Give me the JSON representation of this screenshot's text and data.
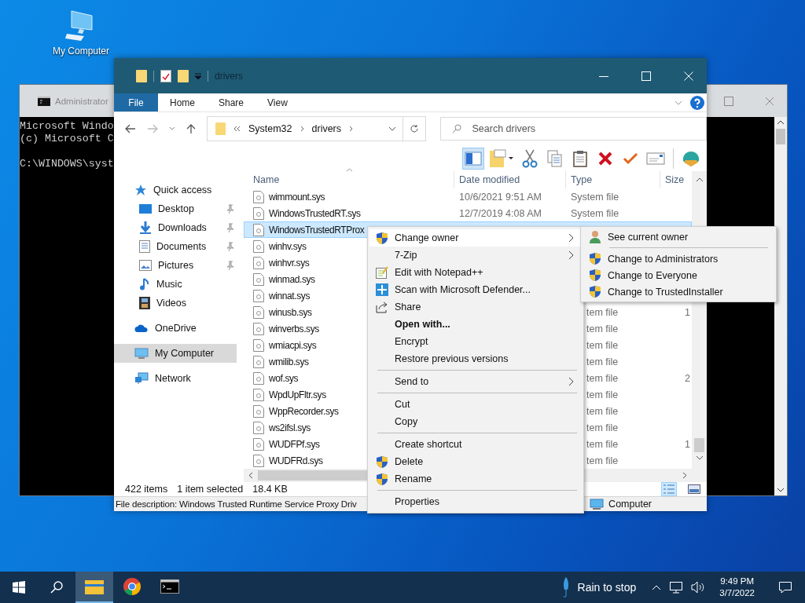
{
  "desktop_icons": [
    {
      "label": "My Computer"
    }
  ],
  "console_window": {
    "title": "Administrator",
    "blocks": [
      [
        "Microsoft Windo",
        "(c) Microsoft C"
      ],
      [
        "C:\\WINDOWS\\syst"
      ]
    ]
  },
  "explorer": {
    "title": "drivers",
    "ribbon_tabs": [
      {
        "label": "File",
        "selected": true
      },
      {
        "label": "Home",
        "selected": false
      },
      {
        "label": "Share",
        "selected": false
      },
      {
        "label": "View",
        "selected": false
      }
    ],
    "address": {
      "path": [
        "System32",
        "drivers"
      ]
    },
    "search": {
      "placeholder": "Search drivers"
    },
    "toolbar": [
      {
        "kind": "preview-pane",
        "selected": true
      },
      {
        "kind": "new-folder",
        "selected": false
      },
      {
        "kind": "cut",
        "selected": false
      },
      {
        "kind": "copy",
        "selected": false
      },
      {
        "kind": "paste",
        "selected": false
      },
      {
        "kind": "delete",
        "selected": false
      },
      {
        "kind": "check",
        "selected": false
      },
      {
        "kind": "mail",
        "selected": false
      },
      {
        "kind": "shell",
        "selected": false
      }
    ],
    "sidebar": [
      {
        "label": "Quick access",
        "selected": false,
        "children": [
          {
            "label": "Desktop",
            "pinned": true,
            "selected": false
          },
          {
            "label": "Downloads",
            "pinned": true,
            "selected": false
          },
          {
            "label": "Documents",
            "pinned": true,
            "selected": false
          },
          {
            "label": "Pictures",
            "pinned": true,
            "selected": false
          },
          {
            "label": "Music",
            "pinned": false,
            "selected": false
          },
          {
            "label": "Videos",
            "pinned": false,
            "selected": false
          }
        ]
      },
      {
        "label": "OneDrive",
        "selected": false
      },
      {
        "label": "My Computer",
        "selected": true
      },
      {
        "label": "Network",
        "selected": false
      }
    ],
    "columns": [
      {
        "label": "Name",
        "sorted": true
      },
      {
        "label": "Date modified",
        "sorted": false
      },
      {
        "label": "Type",
        "sorted": false
      },
      {
        "label": "Size",
        "sorted": false
      }
    ],
    "rows": [
      {
        "name": "wimmount.sys",
        "date": "10/6/2021 9:51 AM",
        "type": "System file",
        "selected": false
      },
      {
        "name": "WindowsTrustedRT.sys",
        "date": "12/7/2019 4:08 AM",
        "type": "System file",
        "selected": false
      },
      {
        "name": "WindowsTrustedRTProx",
        "selected": true
      },
      {
        "name": "winhv.sys",
        "selected": false
      },
      {
        "name": "winhvr.sys",
        "selected": false
      },
      {
        "name": "winmad.sys",
        "selected": false
      },
      {
        "name": "winnat.sys",
        "selected": false
      },
      {
        "name": "winusb.sys",
        "type": "tem file",
        "size": "1",
        "selected": false
      },
      {
        "name": "winverbs.sys",
        "type": "tem file",
        "selected": false
      },
      {
        "name": "wmiacpi.sys",
        "type": "tem file",
        "selected": false
      },
      {
        "name": "wmilib.sys",
        "type": "tem file",
        "selected": false
      },
      {
        "name": "wof.sys",
        "type": "tem file",
        "size": "2",
        "selected": false
      },
      {
        "name": "WpdUpFltr.sys",
        "type": "tem file",
        "selected": false
      },
      {
        "name": "WppRecorder.sys",
        "type": "tem file",
        "selected": false
      },
      {
        "name": "ws2ifsl.sys",
        "type": "tem file",
        "selected": false
      },
      {
        "name": "WUDFPf.sys",
        "type": "tem file",
        "size": "1",
        "selected": false
      },
      {
        "name": "WUDFRd.sys",
        "type": "tem file",
        "selected": false
      }
    ],
    "status": {
      "item_count": "422 items",
      "selection": "1 item selected",
      "size": "18.4 KB"
    },
    "view_buttons": [
      {
        "kind": "details",
        "selected": true
      },
      {
        "kind": "tiles",
        "selected": false
      }
    ],
    "description": {
      "text": "File description: Windows Trusted Runtime Service Proxy Driv",
      "location": "Computer"
    }
  },
  "context_menu": [
    {
      "kind": "shield",
      "label": "Change owner",
      "submenu": true,
      "bold": false,
      "selected": true
    },
    {
      "kind": "plain",
      "label": "7-Zip",
      "submenu": true,
      "bold": false,
      "selected": false
    },
    {
      "kind": "notepad",
      "label": "Edit with Notepad++",
      "submenu": false,
      "bold": false,
      "selected": false
    },
    {
      "kind": "defender",
      "label": "Scan with Microsoft Defender...",
      "submenu": false,
      "bold": false,
      "selected": false
    },
    {
      "kind": "share",
      "label": "Share",
      "submenu": false,
      "bold": false,
      "selected": false
    },
    {
      "kind": "plain",
      "label": "Open with...",
      "submenu": false,
      "bold": true,
      "selected": false
    },
    {
      "kind": "plain",
      "label": "Encrypt",
      "submenu": false,
      "bold": false,
      "selected": false
    },
    {
      "kind": "plain",
      "label": "Restore previous versions",
      "submenu": false,
      "bold": false,
      "selected": false
    },
    {
      "kind": "separator"
    },
    {
      "kind": "plain",
      "label": "Send to",
      "submenu": true,
      "bold": false,
      "selected": false
    },
    {
      "kind": "separator"
    },
    {
      "kind": "plain",
      "label": "Cut",
      "submenu": false,
      "bold": false,
      "selected": false
    },
    {
      "kind": "plain",
      "label": "Copy",
      "submenu": false,
      "bold": false,
      "selected": false
    },
    {
      "kind": "separator"
    },
    {
      "kind": "plain",
      "label": "Create shortcut",
      "submenu": false,
      "bold": false,
      "selected": false
    },
    {
      "kind": "shield",
      "label": "Delete",
      "submenu": false,
      "bold": false,
      "selected": false
    },
    {
      "kind": "shield",
      "label": "Rename",
      "submenu": false,
      "bold": false,
      "selected": false
    },
    {
      "kind": "separator"
    },
    {
      "kind": "plain",
      "label": "Properties",
      "submenu": false,
      "bold": false,
      "selected": false
    }
  ],
  "submenu": [
    {
      "kind": "person",
      "label": "See current owner"
    },
    {
      "kind": "separator"
    },
    {
      "kind": "shield",
      "label": "Change to Administrators"
    },
    {
      "kind": "shield",
      "label": "Change to Everyone"
    },
    {
      "kind": "shield",
      "label": "Change to TrustedInstaller"
    }
  ],
  "taskbar": {
    "apps": [
      {
        "kind": "explorer",
        "selected": true
      },
      {
        "kind": "chrome",
        "selected": false
      },
      {
        "kind": "terminal",
        "selected": false
      }
    ],
    "weather": "Rain to stop",
    "time": "9:49 PM",
    "date": "3/7/2022"
  }
}
